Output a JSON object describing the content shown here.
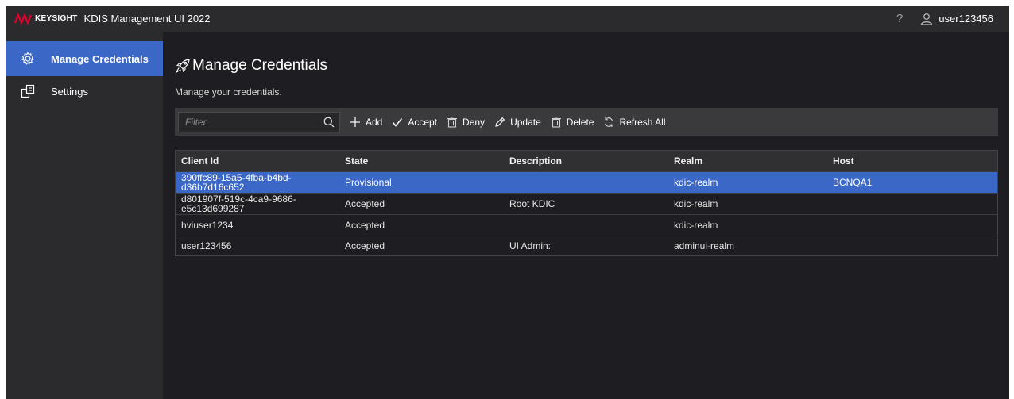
{
  "header": {
    "brand": "KEYSIGHT",
    "title": "KDIS Management UI 2022",
    "help": "?",
    "username": "user123456"
  },
  "sidebar": {
    "items": [
      {
        "label": "Manage Credentials",
        "icon": "gear-icon",
        "active": true
      },
      {
        "label": "Settings",
        "icon": "settings-icon",
        "active": false
      }
    ]
  },
  "main": {
    "title": "Manage Credentials",
    "subtitle": "Manage your credentials.",
    "filter_placeholder": "Filter",
    "toolbar": {
      "add": "Add",
      "accept": "Accept",
      "deny": "Deny",
      "update": "Update",
      "delete": "Delete",
      "refresh_all": "Refresh All"
    },
    "table": {
      "columns": [
        "Client Id",
        "State",
        "Description",
        "Realm",
        "Host"
      ],
      "rows": [
        {
          "client_id": "390ffc89-15a5-4fba-b4bd-d36b7d16c652",
          "state": "Provisional",
          "description": "",
          "realm": "kdic-realm",
          "host": "BCNQA1",
          "selected": true
        },
        {
          "client_id": "d801907f-519c-4ca9-9686-e5c13d699287",
          "state": "Accepted",
          "description": "Root KDIC",
          "realm": "kdic-realm",
          "host": ""
        },
        {
          "client_id": "hviuser1234",
          "state": "Accepted",
          "description": "",
          "realm": "kdic-realm",
          "host": ""
        },
        {
          "client_id": "user123456",
          "state": "Accepted",
          "description": "UI Admin:",
          "realm": "adminui-realm",
          "host": ""
        }
      ]
    }
  },
  "colors": {
    "accent": "#3b67c7",
    "brand_red": "#e4002b",
    "background": "#1e1e22",
    "panel": "#2b2b2e"
  }
}
